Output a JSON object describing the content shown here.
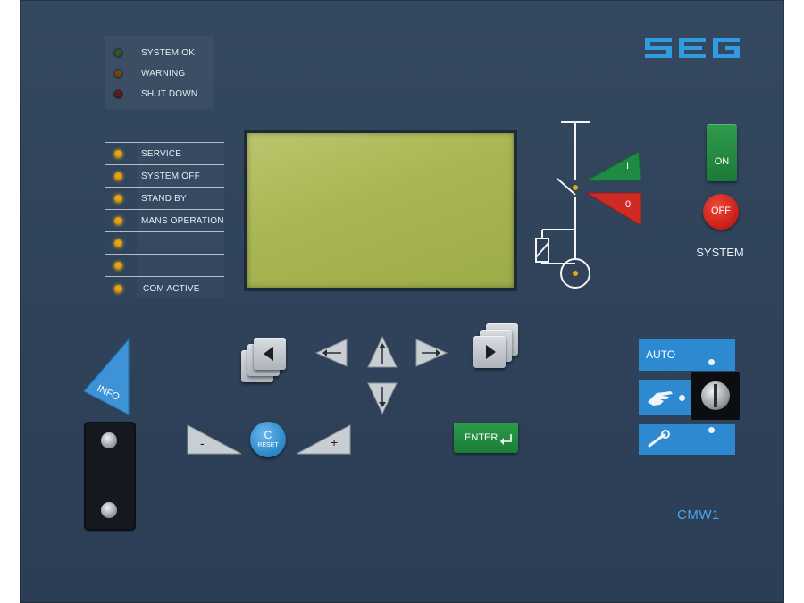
{
  "brand": {
    "logo_text": "SEG",
    "model": "CMW1",
    "accent_color": "#2f9be0"
  },
  "status_leds": [
    {
      "label": "SYSTEM OK",
      "color": "green",
      "state": "off"
    },
    {
      "label": "WARNING",
      "color": "amber",
      "state": "off"
    },
    {
      "label": "SHUT DOWN",
      "color": "red",
      "state": "off"
    }
  ],
  "mode_leds": [
    {
      "label": "SERVICE",
      "state": "on"
    },
    {
      "label": "SYSTEM OFF",
      "state": "on"
    },
    {
      "label": "STAND BY",
      "state": "on"
    },
    {
      "label": "MANS OPERATION",
      "state": "on"
    },
    {
      "label": "",
      "state": "on"
    },
    {
      "label": "",
      "state": "on"
    },
    {
      "label": "COM ACTIVE",
      "state": "on"
    }
  ],
  "breaker": {
    "close_label": "I",
    "open_label": "0"
  },
  "system": {
    "on_label": "ON",
    "off_label": "OFF",
    "caption": "SYSTEM"
  },
  "keys": {
    "info_label": "INFO",
    "enter_label": "ENTER",
    "reset_c": "C",
    "reset_label": "RESET",
    "minus_label": "-",
    "plus_label": "+"
  },
  "mode_selector": {
    "auto_label": "AUTO",
    "positions": [
      "AUTO",
      "manual-hand-icon",
      "wrench-icon"
    ]
  }
}
